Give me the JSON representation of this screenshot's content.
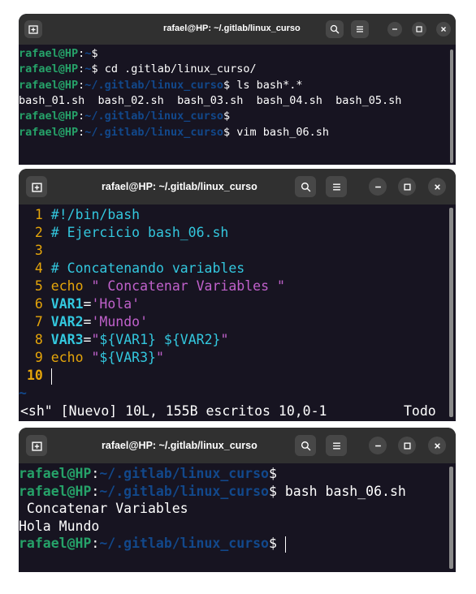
{
  "window1": {
    "title": "rafael@HP: ~/.gitlab/linux_curso",
    "lines": [
      {
        "user": "rafael@HP",
        "sep": ":",
        "path": "~",
        "dollar": "$",
        "cmd": ""
      },
      {
        "user": "rafael@HP",
        "sep": ":",
        "path": "~",
        "dollar": "$",
        "cmd": " cd .gitlab/linux_curso/"
      },
      {
        "user": "rafael@HP",
        "sep": ":",
        "path": "~/.gitlab/linux_curso",
        "dollar": "$",
        "cmd": " ls bash*.*"
      },
      {
        "output": "bash_01.sh  bash_02.sh  bash_03.sh  bash_04.sh  bash_05.sh"
      },
      {
        "user": "rafael@HP",
        "sep": ":",
        "path": "~/.gitlab/linux_curso",
        "dollar": "$",
        "cmd": ""
      },
      {
        "user": "rafael@HP",
        "sep": ":",
        "path": "~/.gitlab/linux_curso",
        "dollar": "$",
        "cmd": " vim bash_06.sh"
      }
    ]
  },
  "window2": {
    "title": "rafael@HP: ~/.gitlab/linux_curso",
    "lines": [
      {
        "num": " 1",
        "segments": [
          {
            "t": " #!/bin/bash",
            "c": "cmt"
          }
        ]
      },
      {
        "num": " 2",
        "segments": [
          {
            "t": " # Ejercicio bash_06.sh",
            "c": "cmt"
          }
        ]
      },
      {
        "num": " 3",
        "segments": []
      },
      {
        "num": " 4",
        "segments": [
          {
            "t": " # Concatenando variables",
            "c": "cmt"
          }
        ]
      },
      {
        "num": " 5",
        "segments": [
          {
            "t": " echo",
            "c": "kw"
          },
          {
            "t": " \"",
            "c": "str"
          },
          {
            "t": " Concatenar Variables ",
            "c": "str"
          },
          {
            "t": "\"",
            "c": "str"
          }
        ]
      },
      {
        "num": " 6",
        "segments": [
          {
            "t": " VAR1",
            "c": "var"
          },
          {
            "t": "=",
            "c": "w"
          },
          {
            "t": "'Hola'",
            "c": "str"
          }
        ]
      },
      {
        "num": " 7",
        "segments": [
          {
            "t": " VAR2",
            "c": "var"
          },
          {
            "t": "=",
            "c": "w"
          },
          {
            "t": "'Mundo'",
            "c": "str"
          }
        ]
      },
      {
        "num": " 8",
        "segments": [
          {
            "t": " VAR3",
            "c": "var"
          },
          {
            "t": "=",
            "c": "w"
          },
          {
            "t": "\"",
            "c": "str"
          },
          {
            "t": "${VAR1}",
            "c": "vexp"
          },
          {
            "t": " ",
            "c": "str"
          },
          {
            "t": "${VAR2}",
            "c": "vexp"
          },
          {
            "t": "\"",
            "c": "str"
          }
        ]
      },
      {
        "num": " 9",
        "segments": [
          {
            "t": " echo",
            "c": "kw"
          },
          {
            "t": " \"",
            "c": "str"
          },
          {
            "t": "${VAR3}",
            "c": "vexp"
          },
          {
            "t": "\"",
            "c": "str"
          }
        ]
      },
      {
        "num": "10",
        "segments": [
          {
            "t": " ",
            "c": "w"
          }
        ]
      }
    ],
    "tilde": "~",
    "status_left": "<sh\" [Nuevo] 10L, 155B escritos 10,0-1",
    "status_right": "Todo"
  },
  "window3": {
    "title": "rafael@HP: ~/.gitlab/linux_curso",
    "lines": [
      {
        "user": "rafael@HP",
        "sep": ":",
        "path": "~/.gitlab/linux_curso",
        "dollar": "$",
        "cmd": ""
      },
      {
        "user": "rafael@HP",
        "sep": ":",
        "path": "~/.gitlab/linux_curso",
        "dollar": "$",
        "cmd": " bash bash_06.sh"
      },
      {
        "output": " Concatenar Variables"
      },
      {
        "output": "Hola Mundo"
      },
      {
        "user": "rafael@HP",
        "sep": ":",
        "path": "~/.gitlab/linux_curso",
        "dollar": "$",
        "cmd": " "
      }
    ]
  },
  "icons": {
    "new_tab": "new-tab-icon",
    "search": "search-icon",
    "menu": "hamburger-menu-icon",
    "minimize": "minimize-icon",
    "maximize": "maximize-icon",
    "close": "close-icon"
  },
  "colors": {
    "terminal_bg": "#171421",
    "titlebar_bg": "#303030",
    "prompt_user": "#26a269",
    "prompt_path": "#12488b",
    "vim_line_number": "#e5a50a",
    "vim_comment": "#33c7de",
    "vim_string": "#c061cb"
  }
}
